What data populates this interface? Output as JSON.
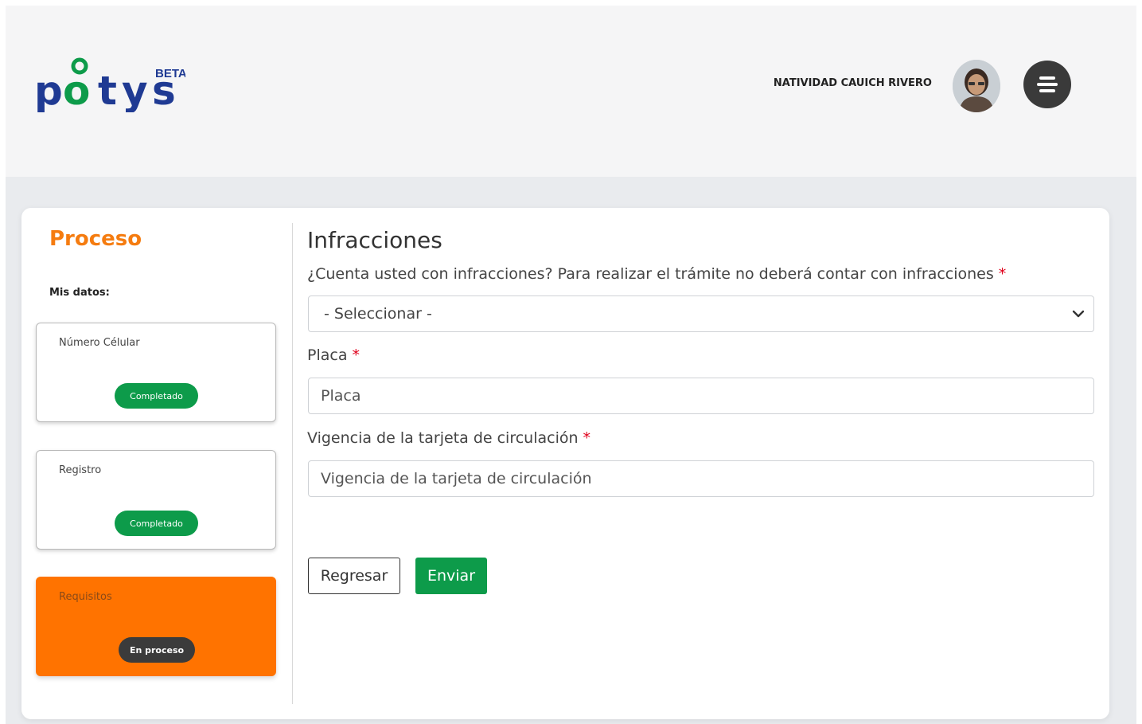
{
  "header": {
    "logo_text": "pötys",
    "beta_label": "BETA",
    "user_name": "NATIVIDAD CAUICH RIVERO"
  },
  "sidebar": {
    "title": "Proceso",
    "section_label": "Mis datos:",
    "steps": [
      {
        "label": "Número Célular",
        "status": "Completado"
      },
      {
        "label": "Registro",
        "status": "Completado"
      },
      {
        "label": "Requisitos",
        "status": "En proceso"
      }
    ]
  },
  "form": {
    "title": "Infracciones",
    "question_label": "¿Cuenta usted con infracciones? Para realizar el trámite no deberá contar con infracciones",
    "question_select_value": "- Seleccionar -",
    "placa_label": "Placa",
    "placa_placeholder": "Placa",
    "vigencia_label": "Vigencia de la tarjeta de circulación",
    "vigencia_placeholder": "Vigencia de la tarjeta de circulación",
    "required_mark": "*",
    "back_label": "Regresar",
    "send_label": "Enviar"
  },
  "colors": {
    "accent_orange": "#ff7300",
    "success_green": "#0d9b4a",
    "logo_blue": "#1f3a93"
  }
}
